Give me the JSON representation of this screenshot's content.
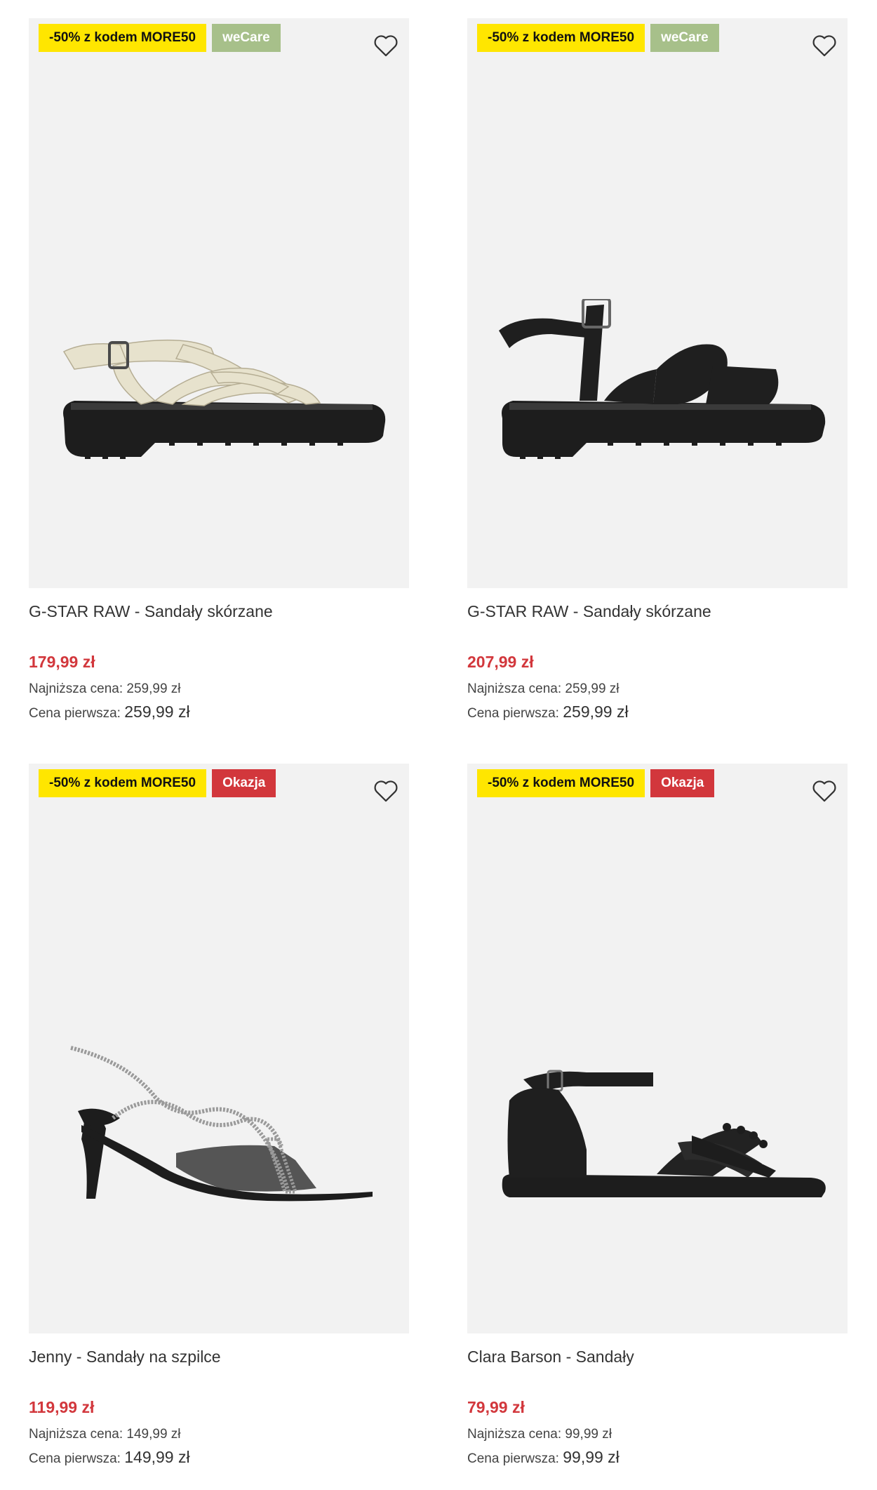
{
  "products": [
    {
      "badges": [
        {
          "label": "-50% z kodem MORE50",
          "kind": "promo"
        },
        {
          "label": "weCare",
          "kind": "wecare"
        }
      ],
      "title": "G-STAR RAW - Sandały skórzane",
      "price": "179,99 zł",
      "lowest_label": "Najniższa cena:",
      "lowest_value": "259,99 zł",
      "first_label": "Cena pierwsza:",
      "first_value": "259,99 zł",
      "image": "cream-fisherman-sandal"
    },
    {
      "badges": [
        {
          "label": "-50% z kodem MORE50",
          "kind": "promo"
        },
        {
          "label": "weCare",
          "kind": "wecare"
        }
      ],
      "title": "G-STAR RAW - Sandały skórzane",
      "price": "207,99 zł",
      "lowest_label": "Najniższa cena:",
      "lowest_value": "259,99 zł",
      "first_label": "Cena pierwsza:",
      "first_value": "259,99 zł",
      "image": "black-buckle-sandal"
    },
    {
      "badges": [
        {
          "label": "-50% z kodem MORE50",
          "kind": "promo"
        },
        {
          "label": "Okazja",
          "kind": "okazja"
        }
      ],
      "title": "Jenny - Sandały na szpilce",
      "price": "119,99 zł",
      "lowest_label": "Najniższa cena:",
      "lowest_value": "149,99 zł",
      "first_label": "Cena pierwsza:",
      "first_value": "149,99 zł",
      "image": "black-heeled-sandal"
    },
    {
      "badges": [
        {
          "label": "-50% z kodem MORE50",
          "kind": "promo"
        },
        {
          "label": "Okazja",
          "kind": "okazja"
        }
      ],
      "title": "Clara Barson - Sandały",
      "price": "79,99 zł",
      "lowest_label": "Najniższa cena:",
      "lowest_value": "99,99 zł",
      "first_label": "Cena pierwsza:",
      "first_value": "99,99 zł",
      "image": "black-flat-sandal"
    }
  ],
  "icons": {
    "wishlist": "heart-outline-icon"
  },
  "colors": {
    "promo": "#ffe600",
    "wecare": "#a7c08a",
    "okazja": "#d2373c",
    "price": "#d2373c",
    "image_bg": "#f2f2f2"
  }
}
